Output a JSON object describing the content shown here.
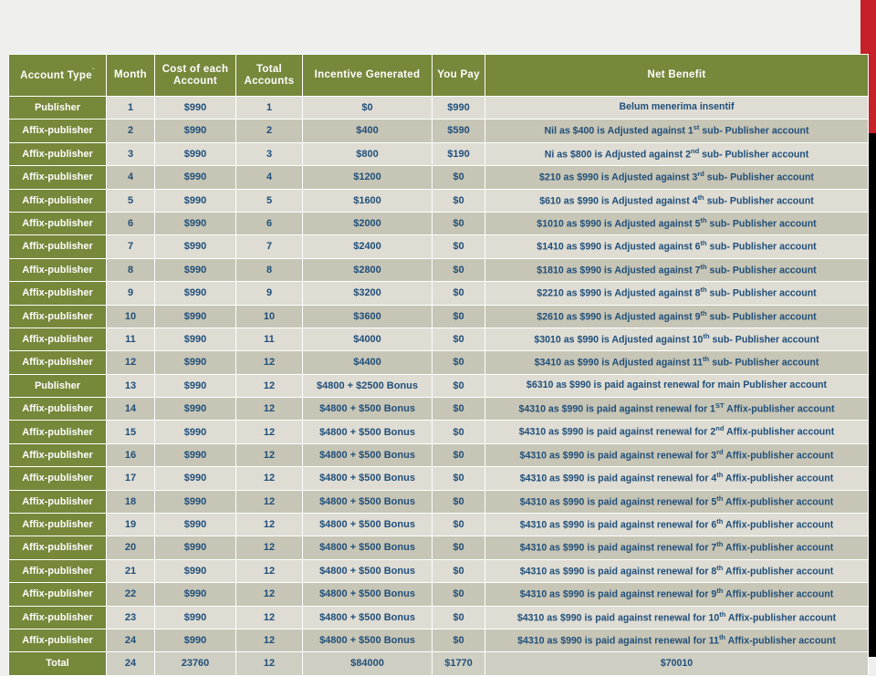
{
  "table": {
    "headers": [
      {
        "label": "Account  Type",
        "mark": "`",
        "name": "account-type"
      },
      {
        "label": "Month",
        "mark": "",
        "name": "month"
      },
      {
        "label": "Cost of each Account",
        "mark": "",
        "name": "cost-of-each-account"
      },
      {
        "label": "Total Accounts",
        "mark": "",
        "name": "total-accounts"
      },
      {
        "label": "Incentive  Generated",
        "mark": "",
        "name": "incentive-generated"
      },
      {
        "label": "You Pay",
        "mark": "",
        "name": "you-pay"
      },
      {
        "label": "Net Benefit",
        "mark": "",
        "name": "net-benefit"
      }
    ],
    "rows": [
      {
        "account_type": "Publisher",
        "month": "1",
        "cost": "$990",
        "total_accounts": "1",
        "incentive": "$0",
        "you_pay": "$990",
        "net_benefit": "Belum menerima insentif"
      },
      {
        "account_type": "Affix-publisher",
        "month": "2",
        "cost": "$990",
        "total_accounts": "2",
        "incentive": "$400",
        "you_pay": "$590",
        "net_benefit": "Nil as $400 is Adjusted  against 1st sub- Publisher  account"
      },
      {
        "account_type": "Affix-publisher",
        "month": "3",
        "cost": "$990",
        "total_accounts": "3",
        "incentive": "$800",
        "you_pay": "$190",
        "net_benefit": "Ni  as  $800 is Adjusted  against 2nd sub- Publisher  account"
      },
      {
        "account_type": "Affix-publisher",
        "month": "4",
        "cost": "$990",
        "total_accounts": "4",
        "incentive": "$1200",
        "you_pay": "$0",
        "net_benefit": "$210 as $990 is Adjusted  against 3rd sub- Publisher account"
      },
      {
        "account_type": "Affix-publisher",
        "month": "5",
        "cost": "$990",
        "total_accounts": "5",
        "incentive": "$1600",
        "you_pay": "$0",
        "net_benefit": "$610 as $990 is Adjusted  against 4th sub- Publisher  account"
      },
      {
        "account_type": "Affix-publisher",
        "month": "6",
        "cost": "$990",
        "total_accounts": "6",
        "incentive": "$2000",
        "you_pay": "$0",
        "net_benefit": "$1010 as $990 is Adjusted  against 5th sub- Publisher  account"
      },
      {
        "account_type": "Affix-publisher",
        "month": "7",
        "cost": "$990",
        "total_accounts": "7",
        "incentive": "$2400",
        "you_pay": "$0",
        "net_benefit": "$1410 as $990 is Adjusted  against 6th sub- Publisher  account"
      },
      {
        "account_type": "Affix-publisher",
        "month": "8",
        "cost": "$990",
        "total_accounts": "8",
        "incentive": "$2800",
        "you_pay": "$0",
        "net_benefit": "$1810 as $990 is Adjusted  against 7th sub- Publisher  account"
      },
      {
        "account_type": "Affix-publisher",
        "month": "9",
        "cost": "$990",
        "total_accounts": "9",
        "incentive": "$3200",
        "you_pay": "$0",
        "net_benefit": "$2210 as $990 is Adjusted  against 8th sub- Publisher  account"
      },
      {
        "account_type": "Affix-publisher",
        "month": "10",
        "cost": "$990",
        "total_accounts": "10",
        "incentive": "$3600",
        "you_pay": "$0",
        "net_benefit": "$2610 as $990 is Adjusted  against 9th sub- Publisher  account"
      },
      {
        "account_type": "Affix-publisher",
        "month": "11",
        "cost": "$990",
        "total_accounts": "11",
        "incentive": "$4000",
        "you_pay": "$0",
        "net_benefit": "$3010 as $990 is Adjusted  against 10th sub- Publisher  account"
      },
      {
        "account_type": "Affix-publisher",
        "month": "12",
        "cost": "$990",
        "total_accounts": "12",
        "incentive": "$4400",
        "you_pay": "$0",
        "net_benefit": "$3410 as $990 is Adjusted  against 11th sub- Publisher  account"
      },
      {
        "account_type": "Publisher",
        "month": "13",
        "cost": "$990",
        "total_accounts": "12",
        "incentive": "$4800 + $2500 Bonus",
        "you_pay": "$0",
        "net_benefit": "$6310 as $990 is paid against renewal  for main Publisher  account"
      },
      {
        "account_type": "Affix-publisher",
        "month": "14",
        "cost": "$990",
        "total_accounts": "12",
        "incentive": "$4800 + $500 Bonus",
        "you_pay": "$0",
        "net_benefit": "$4310 as $990 is paid against renewal  for 1ST Affix-publisher account"
      },
      {
        "account_type": "Affix-publisher",
        "month": "15",
        "cost": "$990",
        "total_accounts": "12",
        "incentive": "$4800 + $500 Bonus",
        "you_pay": "$0",
        "net_benefit": "$4310 as $990 is paid against renewal  for 2nd Affix-publisher account"
      },
      {
        "account_type": "Affix-publisher",
        "month": "16",
        "cost": "$990",
        "total_accounts": "12",
        "incentive": "$4800 + $500 Bonus",
        "you_pay": "$0",
        "net_benefit": "$4310 as $990 is paid against renewal  for 3rd Affix-publisher account"
      },
      {
        "account_type": "Affix-publisher",
        "month": "17",
        "cost": "$990",
        "total_accounts": "12",
        "incentive": "$4800 + $500 Bonus",
        "you_pay": "$0",
        "net_benefit": "$4310 as $990 is paid against renewal  for 4th Affix-publisher account"
      },
      {
        "account_type": "Affix-publisher",
        "month": "18",
        "cost": "$990",
        "total_accounts": "12",
        "incentive": "$4800 + $500 Bonus",
        "you_pay": "$0",
        "net_benefit": "$4310 as $990 is paid against renewal  for 5th Affix-publisher account"
      },
      {
        "account_type": "Affix-publisher",
        "month": "19",
        "cost": "$990",
        "total_accounts": "12",
        "incentive": "$4800 + $500 Bonus",
        "you_pay": "$0",
        "net_benefit": "$4310 as $990 is paid against renewal  for 6th Affix-publisher account"
      },
      {
        "account_type": "Affix-publisher",
        "month": "20",
        "cost": "$990",
        "total_accounts": "12",
        "incentive": "$4800 + $500 Bonus",
        "you_pay": "$0",
        "net_benefit": "$4310 as $990 is paid against renewal  for 7th Affix-publisher account"
      },
      {
        "account_type": "Affix-publisher",
        "month": "21",
        "cost": "$990",
        "total_accounts": "12",
        "incentive": "$4800 + $500 Bonus",
        "you_pay": "$0",
        "net_benefit": "$4310 as $990 is paid against renewal  for 8th Affix-publisher account"
      },
      {
        "account_type": "Affix-publisher",
        "month": "22",
        "cost": "$990",
        "total_accounts": "12",
        "incentive": "$4800 + $500 Bonus",
        "you_pay": "$0",
        "net_benefit": "$4310 as $990 is paid against renewal  for 9th Affix-publisher account"
      },
      {
        "account_type": "Affix-publisher",
        "month": "23",
        "cost": "$990",
        "total_accounts": "12",
        "incentive": "$4800 + $500 Bonus",
        "you_pay": "$0",
        "net_benefit": "$4310 as $990 is paid against renewal  for 10th Affix-publisher account"
      },
      {
        "account_type": "Affix-publisher",
        "month": "24",
        "cost": "$990",
        "total_accounts": "12",
        "incentive": "$4800 + $500 Bonus",
        "you_pay": "$0",
        "net_benefit": "$4310 as $990 is paid against renewal  for 11th Affix-publisher account"
      },
      {
        "account_type": "Total",
        "month": "24",
        "cost": "23760",
        "total_accounts": "12",
        "incentive": "$84000",
        "you_pay": "$1770",
        "net_benefit": "$70010",
        "is_total": true
      }
    ]
  },
  "colors": {
    "header_green": "#76883a",
    "row_light": "#dedcd3",
    "row_dark": "#c7c5b5",
    "text_blue": "#1f4e79",
    "accent_red": "#c62128",
    "accent_black": "#000000",
    "page_background": "#efefed"
  }
}
